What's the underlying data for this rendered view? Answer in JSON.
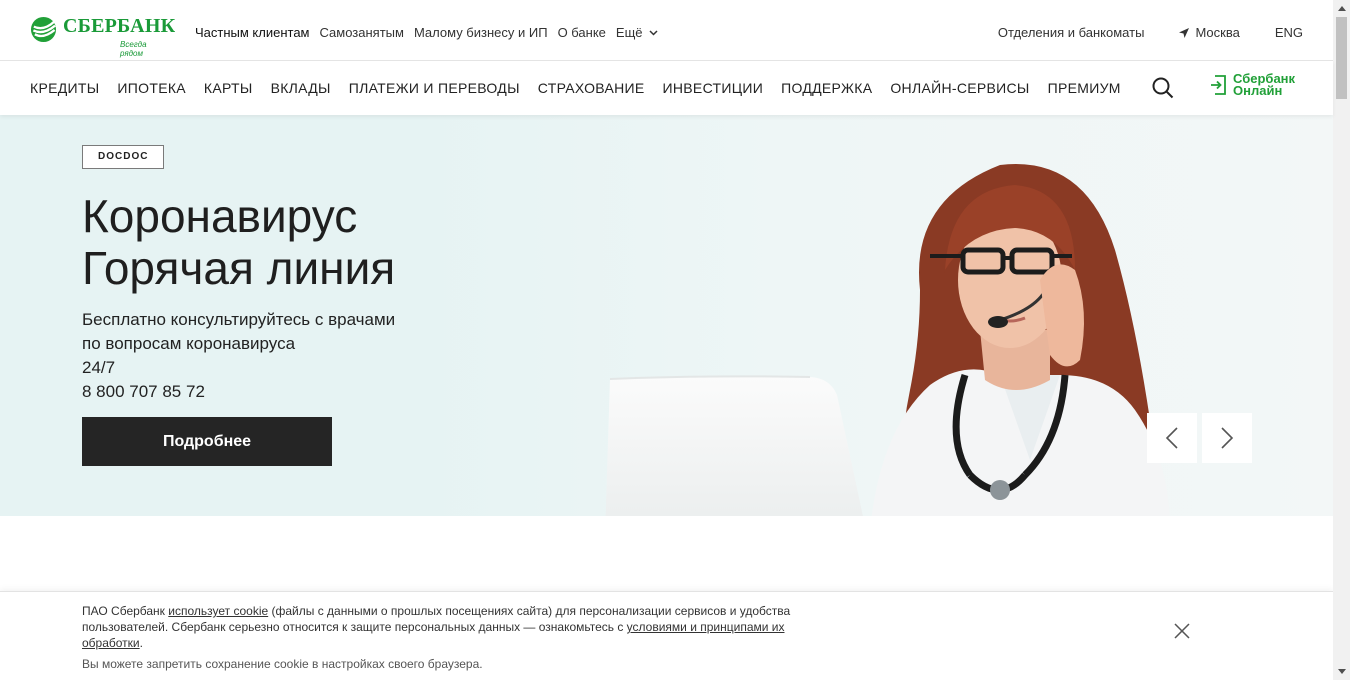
{
  "brand": {
    "name": "СБЕРБАНК",
    "tagline": "Всегда рядом",
    "color": "#21a038"
  },
  "topnav": {
    "items": [
      "Частным клиентам",
      "Самозанятым",
      "Малому бизнесу и ИП",
      "О банке"
    ],
    "more_label": "Ещё",
    "branches": "Отделения и банкоматы",
    "city": "Москва",
    "lang": "ENG"
  },
  "mainnav": {
    "items": [
      "КРЕДИТЫ",
      "ИПОТЕКА",
      "КАРТЫ",
      "ВКЛАДЫ",
      "ПЛАТЕЖИ И ПЕРЕВОДЫ",
      "СТРАХОВАНИЕ",
      "ИНВЕСТИЦИИ",
      "ПОДДЕРЖКА",
      "ОНЛАЙН-СЕРВИСЫ",
      "ПРЕМИУМ"
    ],
    "online_line1": "Сбербанк",
    "online_line2": "Онлайн"
  },
  "hero": {
    "badge": "DOCDOC",
    "title_line1": "Коронавирус",
    "title_line2": "Горячая линия",
    "desc_line1": "Бесплатно консультируйтесь с врачами",
    "desc_line2": "по вопросам коронавируса",
    "desc_line3": "24/7",
    "desc_line4": "8 800 707 85 72",
    "button": "Подробнее",
    "bg_color": "#e6f3f3"
  },
  "cookie": {
    "part1": "ПАО Сбербанк ",
    "link1": "использует cookie",
    "part2": " (файлы с данными о прошлых посещениях сайта) для персонализации сервисов и удобства пользователей. Сбербанк серьезно относится к защите персональных данных — ознакомьтесь с ",
    "link2": "условиями и принципами их обработки",
    "part3": ".",
    "note": "Вы можете запретить сохранение cookie в настройках своего браузера."
  }
}
